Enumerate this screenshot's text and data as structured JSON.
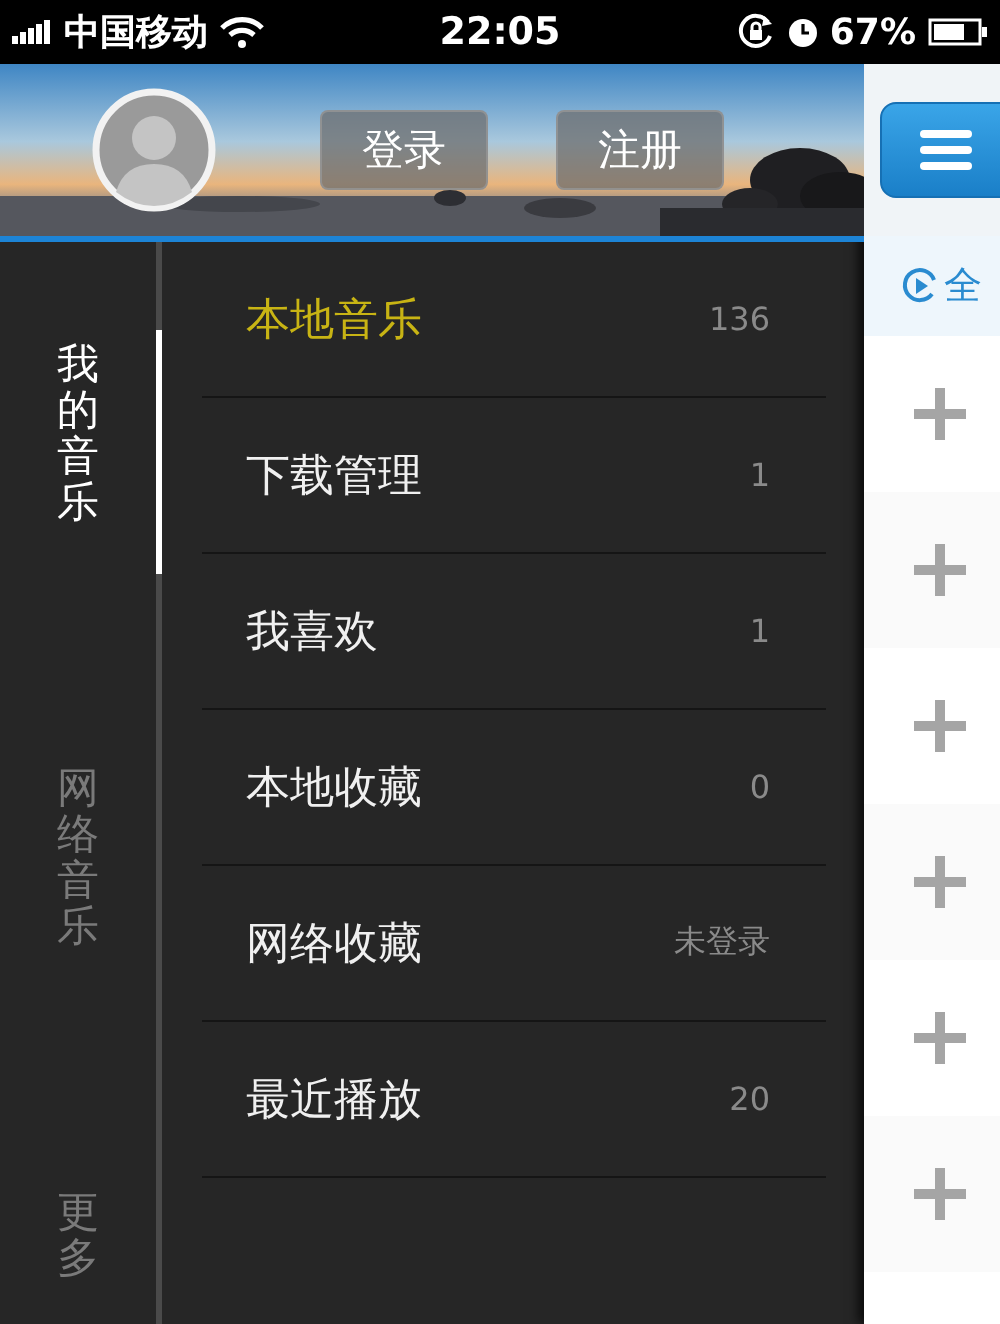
{
  "status_bar": {
    "carrier": "中国移动",
    "time": "22:05",
    "battery": "67%"
  },
  "header": {
    "buttons": [
      "登录",
      "注册"
    ]
  },
  "side_tabs": [
    {
      "label": "我的音乐",
      "selected": true
    },
    {
      "label": "网络音乐",
      "selected": false
    },
    {
      "label": "更多",
      "selected": false
    }
  ],
  "menu": [
    {
      "label": "本地音乐",
      "count": "136",
      "selected": true
    },
    {
      "label": "下载管理",
      "count": "1",
      "selected": false
    },
    {
      "label": "我喜欢",
      "count": "1",
      "selected": false
    },
    {
      "label": "本地收藏",
      "count": "0",
      "selected": false
    },
    {
      "label": "网络收藏",
      "count": "未登录",
      "selected": false
    },
    {
      "label": "最近播放",
      "count": "20",
      "selected": false
    }
  ],
  "right_panel": {
    "play_all": "全",
    "rows": [
      {
        "kind": "add"
      },
      {
        "kind": "add"
      },
      {
        "kind": "add"
      },
      {
        "kind": "add"
      },
      {
        "kind": "add"
      },
      {
        "kind": "add"
      }
    ]
  }
}
